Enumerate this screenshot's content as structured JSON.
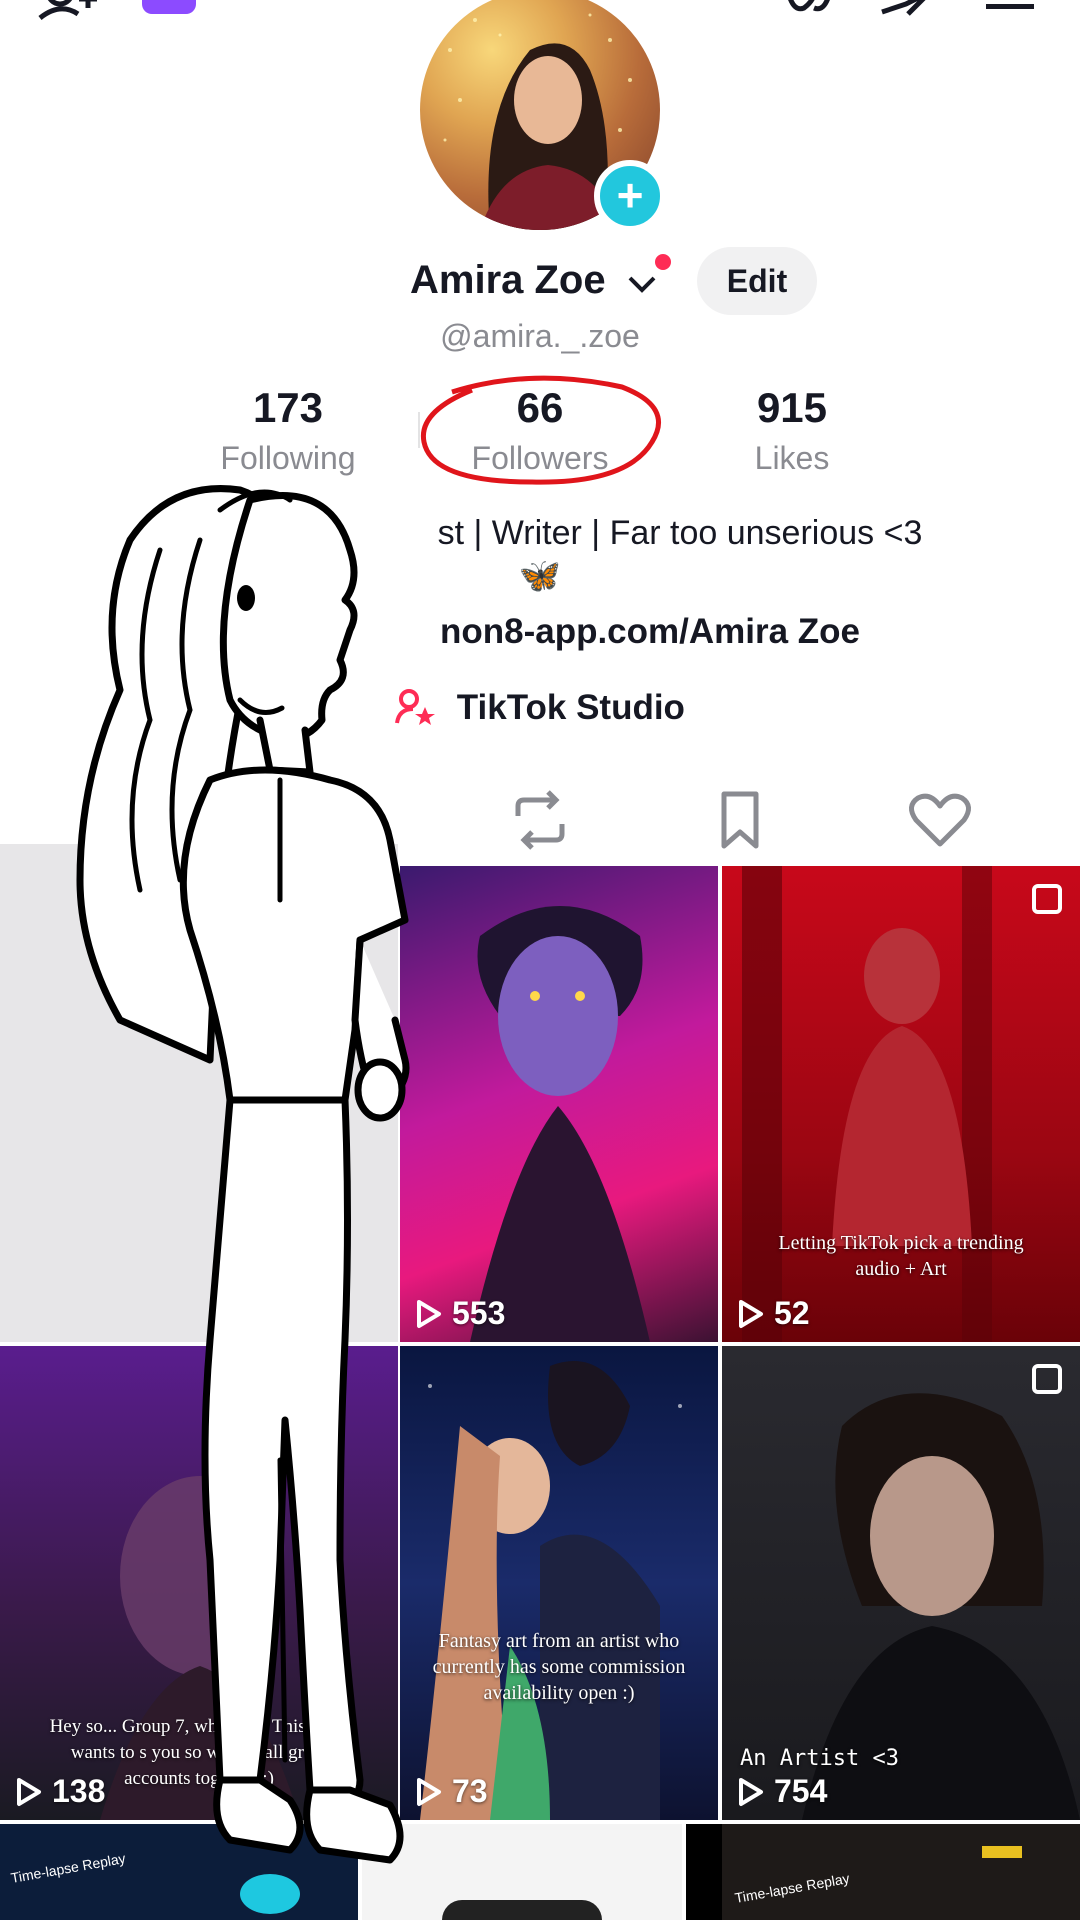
{
  "profile": {
    "name": "Amira Zoe",
    "handle": "@amira._.zoe",
    "edit_label": "Edit",
    "stats": [
      {
        "value": "173",
        "label": "Following"
      },
      {
        "value": "66",
        "label": "Followers"
      },
      {
        "value": "915",
        "label": "Likes"
      }
    ],
    "bio_line1": "st | Writer | Far too unserious <3",
    "bio_emoji": "🦋",
    "link": "non8-app.com/Amira Zoe",
    "studio_label": "TikTok Studio"
  },
  "icons": {
    "top_left": "add-user-icon",
    "top_badge": "notification-badge-icon",
    "top_right": [
      "glasses-icon",
      "share-icon",
      "menu-icon"
    ],
    "tabs": [
      "repost-icon",
      "bookmark-icon",
      "heart-icon"
    ]
  },
  "colors": {
    "accent": "#fe2c55",
    "add_button": "#22c7dd",
    "annotation_circle": "#e0151b"
  },
  "videos": [
    {
      "views": "",
      "caption": ""
    },
    {
      "views": "553",
      "caption": ""
    },
    {
      "views": "52",
      "caption": "Letting TikTok pick a trending audio + Art"
    },
    {
      "views": "138",
      "caption": "Hey so... Group 7, where at? This artist wants to s you so we can all grow accounts together :)"
    },
    {
      "views": "73",
      "caption": "Fantasy art from an artist who currently has some commission availability open :)"
    },
    {
      "views": "754",
      "caption": "An Artist <3"
    }
  ],
  "bottom_row": {
    "left_label": "Time-lapse Replay",
    "right_label": "Time-lapse Replay"
  }
}
